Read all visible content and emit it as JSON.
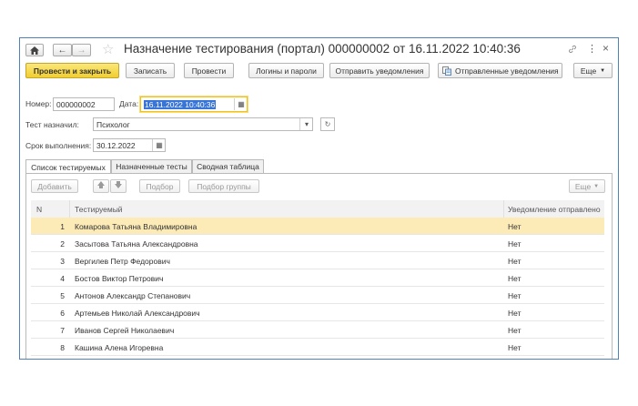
{
  "window": {
    "title": "Назначение тестирования (портал) 000000002 от 16.11.2022 10:40:36",
    "more_menu_glyph": "⋮",
    "close_glyph": "×"
  },
  "toolbar": {
    "post_and_close": "Провести и закрыть",
    "save": "Записать",
    "post": "Провести",
    "logins": "Логины и пароли",
    "send_notification": "Отправить уведомления",
    "sent_notifications": "Отправленные уведомления",
    "more": "Еще"
  },
  "form": {
    "number_label": "Номер:",
    "number_value": "000000002",
    "date_label": "Дата:",
    "date_value": "16.11.2022 10:40:36",
    "assigned_by_label": "Тест назначил:",
    "assigned_by_value": "Психолог",
    "deadline_label": "Срок выполнения:",
    "deadline_value": "30.12.2022"
  },
  "tabs": [
    {
      "label": "Список тестируемых",
      "active": true
    },
    {
      "label": "Назначенные тесты",
      "active": false
    },
    {
      "label": "Сводная таблица",
      "active": false
    }
  ],
  "grid_toolbar": {
    "add": "Добавить",
    "pick": "Подбор",
    "pick_group": "Подбор группы",
    "more": "Еще"
  },
  "table": {
    "columns": [
      "N",
      "Тестируемый",
      "Уведомление отправлено"
    ],
    "rows": [
      {
        "n": "1",
        "name": "Комарова Татьяна Владимировна",
        "notified": "Нет"
      },
      {
        "n": "2",
        "name": "Засытова Татьяна Александровна",
        "notified": "Нет"
      },
      {
        "n": "3",
        "name": "Вергилев Петр Федорович",
        "notified": "Нет"
      },
      {
        "n": "4",
        "name": "Бостов Виктор Петрович",
        "notified": "Нет"
      },
      {
        "n": "5",
        "name": "Антонов Александр Степанович",
        "notified": "Нет"
      },
      {
        "n": "6",
        "name": "Артемьев Николай Александрович",
        "notified": "Нет"
      },
      {
        "n": "7",
        "name": "Иванов Сергей Николаевич",
        "notified": "Нет"
      },
      {
        "n": "8",
        "name": "Кашина Алена Игоревна",
        "notified": "Нет"
      }
    ],
    "selected_row": 0
  },
  "colors": {
    "primary_button": "#f1cf2e",
    "window_border": "#4f81bd",
    "selected_row": "#fcebb6"
  }
}
